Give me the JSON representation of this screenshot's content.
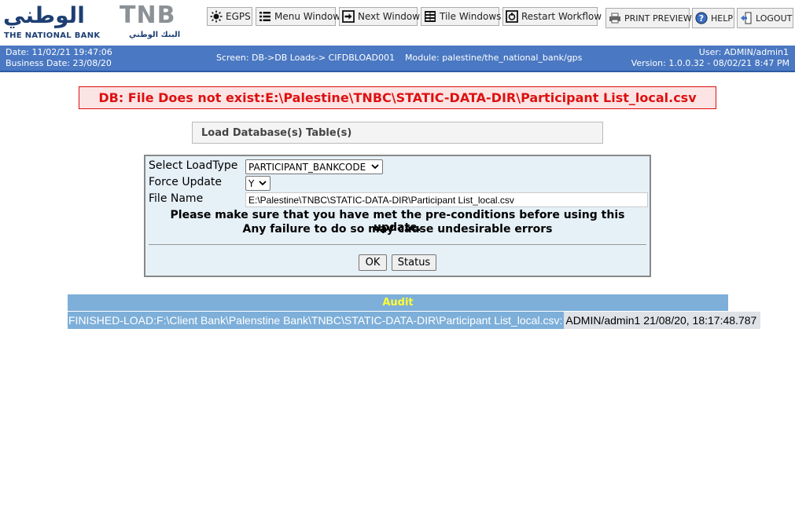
{
  "brand": {
    "arabic_name": "الوطني",
    "short_name": "TNB",
    "english_name": "THE NATIONAL BANK",
    "arabic_tagline": "البنك الوطني",
    "color_navy": "#1d3f73",
    "color_grey": "#8c9196"
  },
  "toolbar": {
    "egps": "EGPS",
    "menu_window": "Menu Window",
    "next_window": "Next Window",
    "tile_windows": "Tile Windows",
    "restart_workflow": "Restart Workflow",
    "print_preview": "PRINT PREVIEW",
    "help": "HELP",
    "logout": "LOGOUT"
  },
  "infobar": {
    "date": "Date: 11/02/21 19:47:06",
    "business_date": "Business Date: 23/08/20",
    "screen": "Screen: DB->DB Loads-> CIFDBLOAD001",
    "module": "Module: palestine/the_national_bank/gps",
    "user": "User: ADMIN/admin1",
    "version": "Version: 1.0.0.32 - 08/02/21 8:47 PM",
    "bg_color": "#4a78c2"
  },
  "error": {
    "message": "DB: File Does not exist:E:\\Palestine\\TNBC\\STATIC-DATA-DIR\\Participant List_local.csv",
    "color": "#dd1111"
  },
  "section": {
    "title": "Load Database(s) Table(s)"
  },
  "form": {
    "load_type_label": "Select LoadType",
    "load_type_value": "PARTICIPANT_BANKCODE",
    "force_update_label": "Force Update",
    "force_update_value": "Y",
    "file_name_label": "File Name",
    "file_name_value": "E:\\Palestine\\TNBC\\STATIC-DATA-DIR\\Participant List_local.csv",
    "note_line1": "Please make sure that you have met the pre-conditions before using this update.",
    "note_line2": "Any failure to do so may cause undesirable errors",
    "ok_label": "OK",
    "status_label": "Status"
  },
  "audit": {
    "title": "Audit",
    "rows": [
      {
        "message": "FINISHED-LOAD:F:\\Client Bank\\Palenstine Bank\\TNBC\\STATIC-DATA-DIR\\Participant List_local.csv:",
        "user": "ADMIN/admin1",
        "timestamp": "21/08/20, 18:17:48.787"
      }
    ]
  }
}
